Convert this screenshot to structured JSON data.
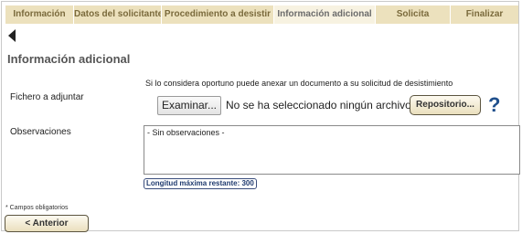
{
  "tabs": [
    {
      "label": "Información",
      "active": false
    },
    {
      "label": "Datos del solicitante",
      "active": false
    },
    {
      "label": "Procedimiento a desistir",
      "active": false
    },
    {
      "label": "Información adicional",
      "active": true
    },
    {
      "label": "Solicita",
      "active": false
    },
    {
      "label": "Finalizar",
      "active": false
    }
  ],
  "back_icon": "back-arrow-icon",
  "section_title": "Información adicional",
  "attachment": {
    "hint": "Si lo considera oportuno puede anexar un documento a su solicitud de desistimiento",
    "label": "Fichero a adjuntar",
    "browse_label": "Examinar...",
    "file_status": "No se ha seleccionado ningún archivo.",
    "repository_label": "Repositorio...",
    "help_icon": "question-mark-icon"
  },
  "observations": {
    "label": "Observaciones",
    "value": "- Sin observaciones -",
    "remaining_label": "Longitud máxima restante: 300"
  },
  "footer": {
    "required_note": "* Campos obligatorios",
    "previous_label": "< Anterior"
  },
  "colors": {
    "tab_bg": "#ece1bd",
    "tab_active_bg": "#f7f2e1",
    "tab_text": "#7a6a3c",
    "help_icon": "#1f4f8c"
  }
}
